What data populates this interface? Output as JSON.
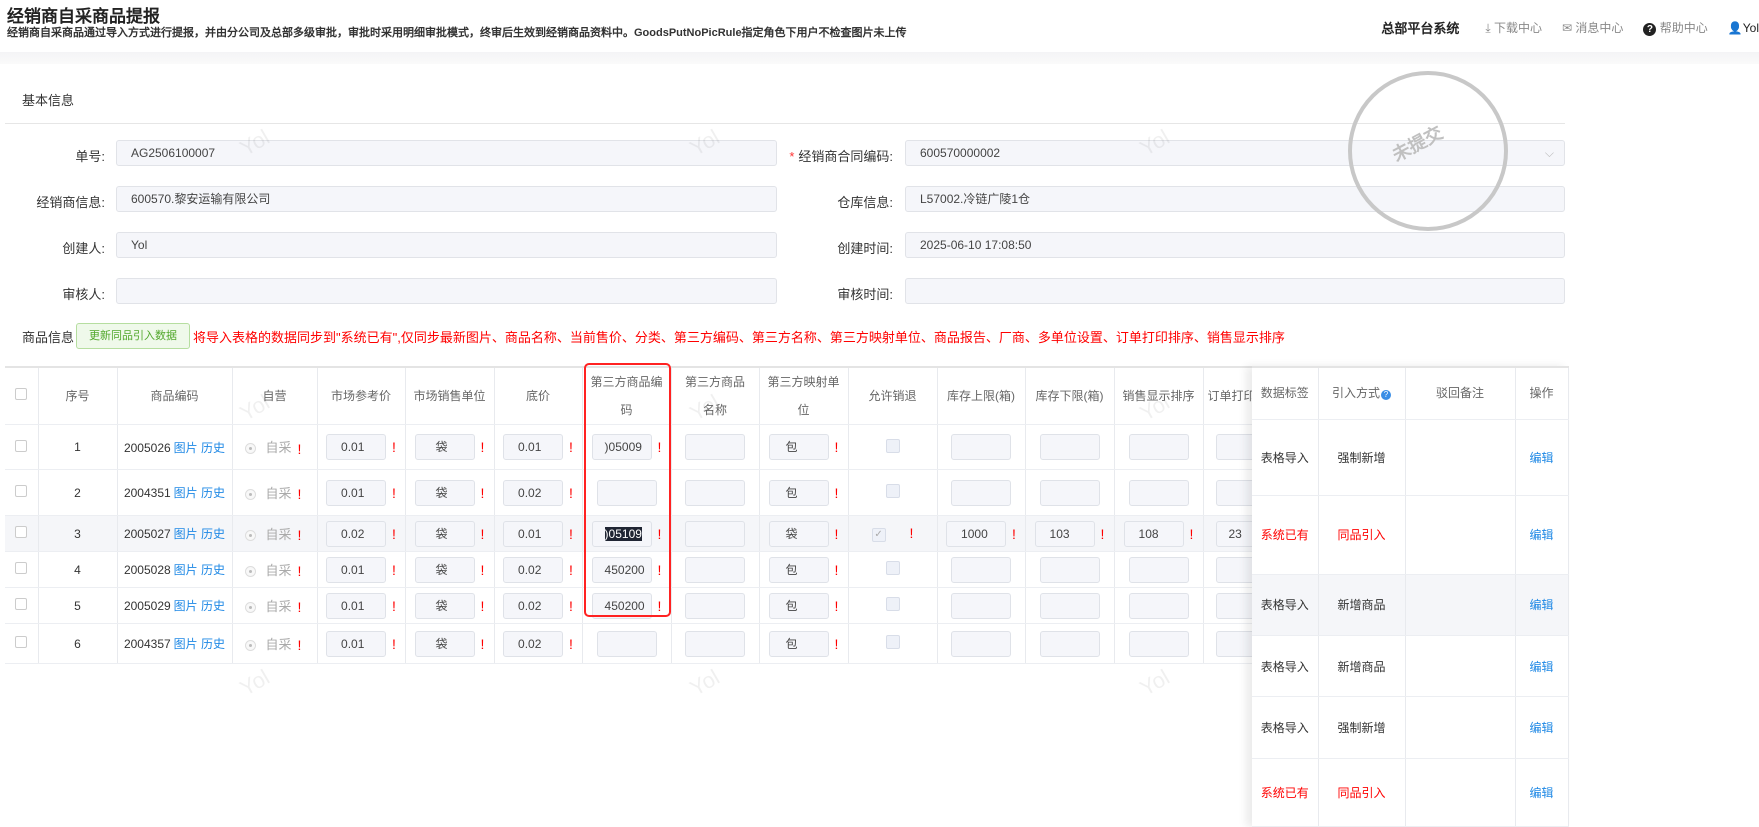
{
  "header": {
    "title": "经销商自采商品提报",
    "subtitle": "经销商自采商品通过导入方式进行提报，并由分公司及总部多级审批，审批时采用明细审批模式，终审后生效到经销商品资料中。GoodsPutNoPicRule指定角色下用户不检查图片未上传",
    "system": "总部平台系统",
    "download": "下载中心",
    "messages": "消息中心",
    "help": "帮助中心",
    "user": "Yol"
  },
  "basic": {
    "section": "基本信息",
    "stamp": "未提交",
    "watermark": "Yol",
    "fields": [
      {
        "label": "单号:",
        "value": "AG2506100007"
      },
      {
        "label": "经销商合同编码:",
        "value": "600570000002",
        "required": "*"
      },
      {
        "label": "经销商信息:",
        "value": "600570.黎安运输有限公司"
      },
      {
        "label": "仓库信息:",
        "value": "L57002.冷链广陵1仓"
      },
      {
        "label": "创建人:",
        "value": "Yol"
      },
      {
        "label": "创建时间:",
        "value": "2025-06-10 17:08:50"
      },
      {
        "label": "审核人:",
        "value": ""
      },
      {
        "label": "审核时间:",
        "value": ""
      }
    ]
  },
  "goods": {
    "section": "商品信息",
    "update_button": "更新同品引入数据",
    "tip": "将导入表格的数据同步到\"系统已有\",仅同步最新图片、商品名称、当前售价、分类、第三方编码、第三方名称、第三方映射单位、商品报告、厂商、多单位设置、订单打印排序、销售显示排序",
    "columns": [
      "序号",
      "商品编码",
      "自营",
      "市场参考价",
      "市场销售单位",
      "底价",
      "第三方商品编码",
      "第三方商品名称",
      "第三方映射单位",
      "允许销退",
      "库存上限(箱)",
      "库存下限(箱)",
      "销售显示排序",
      "订单打印",
      "数据标签",
      "引入方式",
      "驳回备注",
      "操作"
    ],
    "pic": "图片",
    "history": "历史",
    "self": "自采",
    "edit": "编辑",
    "rows": [
      {
        "no": "1",
        "code": "2005026",
        "ref_price": "0.01",
        "unit": "袋",
        "floor": "0.01",
        "tp_code": ")05009",
        "tp_name": "",
        "tp_unit": "包",
        "allow_return": false,
        "max": "",
        "min": "",
        "sale_sort": "",
        "print_sort": "",
        "tag": "表格导入",
        "mode": "强制新增",
        "tag_red": false
      },
      {
        "no": "2",
        "code": "2004351",
        "ref_price": "0.01",
        "unit": "袋",
        "floor": "0.02",
        "tp_code": "",
        "tp_name": "",
        "tp_unit": "包",
        "allow_return": false,
        "max": "",
        "min": "",
        "sale_sort": "",
        "print_sort": "",
        "tag": "系统已有",
        "mode": "同品引入",
        "tag_red": true
      },
      {
        "no": "3",
        "code": "2005027",
        "ref_price": "0.02",
        "unit": "袋",
        "floor": "0.01",
        "tp_code": ")05109",
        "tp_name": "",
        "tp_unit": "袋",
        "allow_return": true,
        "max": "1000",
        "min": "103",
        "sale_sort": "108",
        "print_sort": "23",
        "tag": "表格导入",
        "mode": "新增商品",
        "tag_red": false
      },
      {
        "no": "4",
        "code": "2005028",
        "ref_price": "0.01",
        "unit": "袋",
        "floor": "0.02",
        "tp_code": "450200",
        "tp_name": "",
        "tp_unit": "包",
        "allow_return": false,
        "max": "",
        "min": "",
        "sale_sort": "",
        "print_sort": "",
        "tag": "表格导入",
        "mode": "新增商品",
        "tag_red": false
      },
      {
        "no": "5",
        "code": "2005029",
        "ref_price": "0.01",
        "unit": "袋",
        "floor": "0.02",
        "tp_code": "450200",
        "tp_name": "",
        "tp_unit": "包",
        "allow_return": false,
        "max": "",
        "min": "",
        "sale_sort": "",
        "print_sort": "",
        "tag": "表格导入",
        "mode": "强制新增",
        "tag_red": false
      },
      {
        "no": "6",
        "code": "2004357",
        "ref_price": "0.01",
        "unit": "袋",
        "floor": "0.02",
        "tp_code": "",
        "tp_name": "",
        "tp_unit": "包",
        "allow_return": false,
        "max": "",
        "min": "",
        "sale_sort": "",
        "print_sort": "",
        "tag": "系统已有",
        "mode": "同品引入",
        "tag_red": true
      }
    ]
  }
}
